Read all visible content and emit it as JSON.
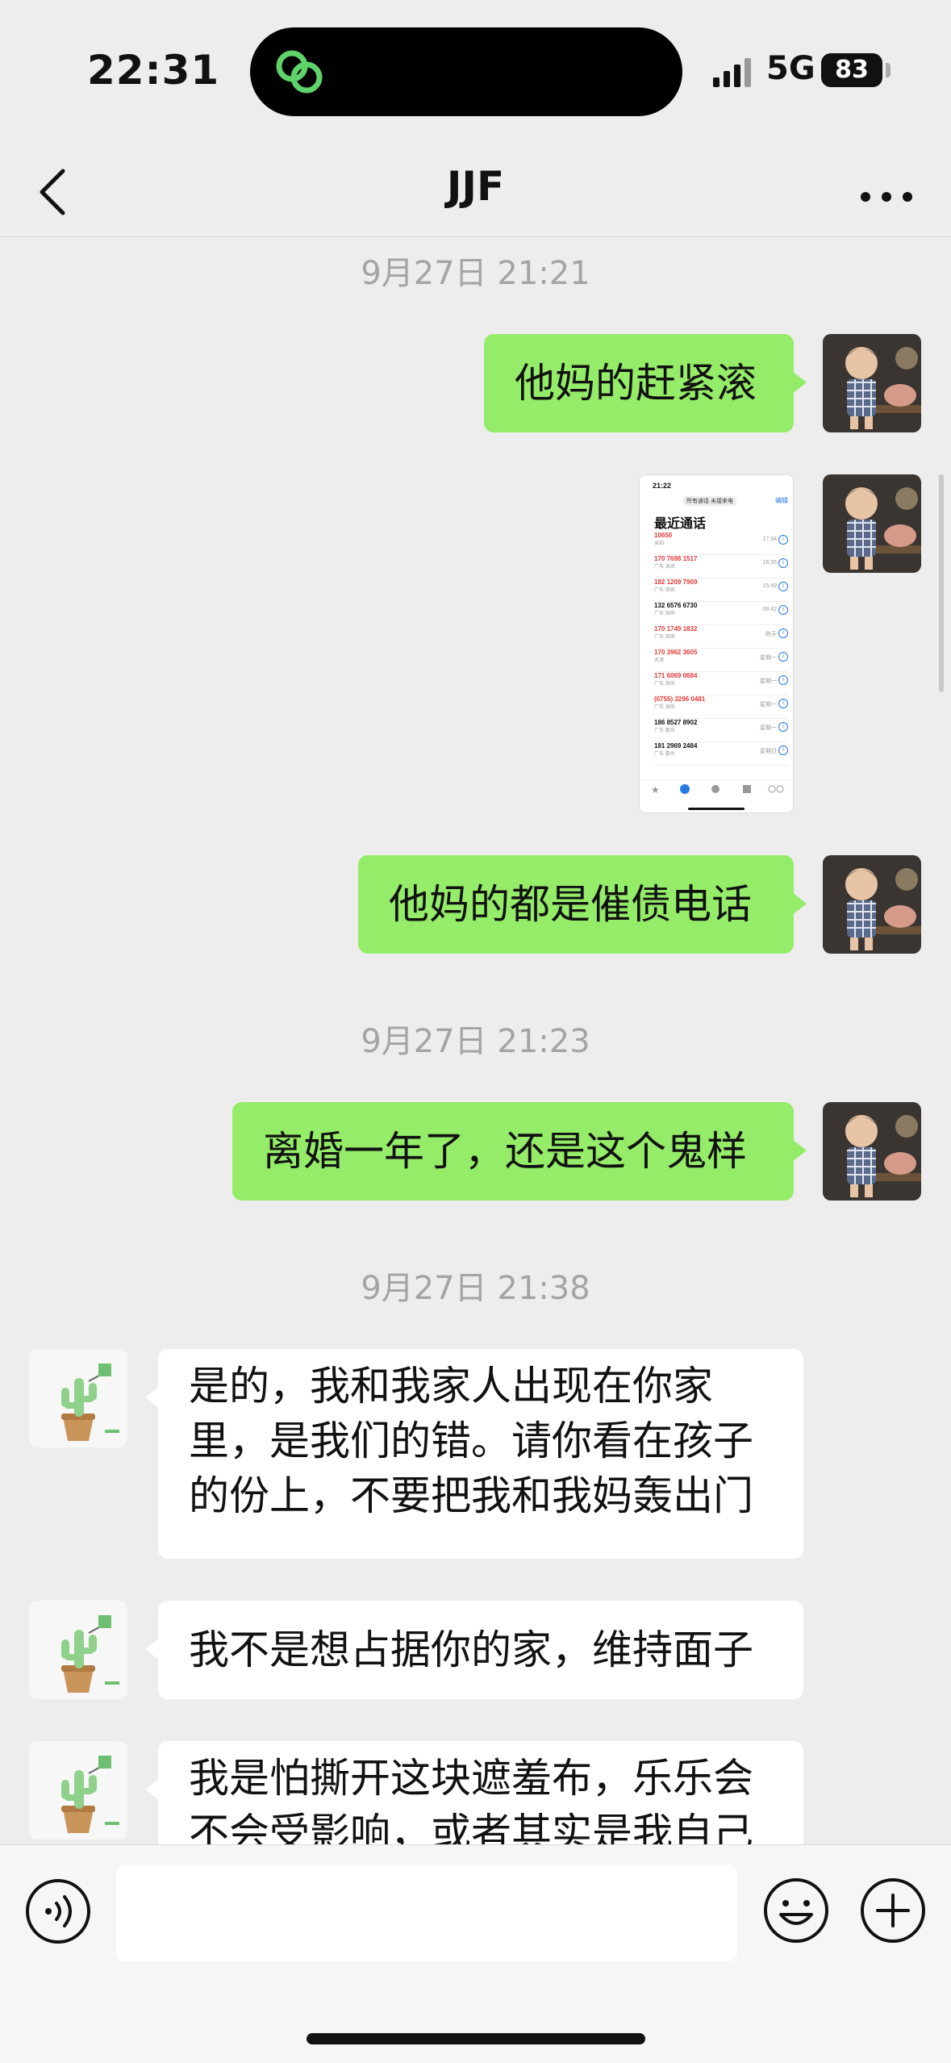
{
  "status_bar": {
    "time": "22:31",
    "network": "5G",
    "battery": "83"
  },
  "header": {
    "title": "JJF"
  },
  "timestamps": [
    "9月27日 21:21",
    "9月27日 21:23",
    "9月27日 21:38"
  ],
  "messages": {
    "out_1": "他妈的赶紧滚",
    "out_2": "他妈的都是催债电话",
    "out_3": "离婚一年了，还是这个鬼样",
    "in_1": [
      "是的，我和我家人出现在你家",
      "里，是我们的错。请你看在孩子",
      "的份上，不要把我和我妈轰出门"
    ],
    "in_2": "我不是想占据你的家，维持面子",
    "in_3": [
      "我是怕撕开这块遮羞布，乐乐会",
      "不会受影响，或者其实是我自己"
    ]
  },
  "screenshot_thumb": {
    "time": "21:22",
    "segment": "所有通话  未接来电",
    "edit": "编辑",
    "title": "最近通话",
    "rows": [
      {
        "number": "10650",
        "sub": "未知",
        "when": "17:34",
        "missed": true
      },
      {
        "number": "170 7698 1517",
        "sub": "广东 深圳",
        "when": "16:35",
        "missed": true
      },
      {
        "number": "182 1209 7909",
        "sub": "广东 深圳",
        "when": "15:59",
        "missed": true
      },
      {
        "number": "132 6576 6730",
        "sub": "广东 深圳",
        "when": "09:42",
        "missed": false
      },
      {
        "number": "170 1749 1832",
        "sub": "广东 深圳",
        "when": "昨天",
        "missed": true
      },
      {
        "number": "170 3962 3605",
        "sub": "天津",
        "when": "星期一",
        "missed": true
      },
      {
        "number": "171 6069 0684",
        "sub": "广东 深圳",
        "when": "星期一",
        "missed": true
      },
      {
        "number": "(0755) 3296 0481",
        "sub": "广东 深圳",
        "when": "星期一",
        "missed": true
      },
      {
        "number": "186 8527 8902",
        "sub": "广东 惠州",
        "when": "星期一",
        "missed": false
      },
      {
        "number": "181 2969 2484",
        "sub": "广东 惠州",
        "when": "星期日",
        "missed": false
      }
    ]
  },
  "input": {
    "placeholder": ""
  },
  "colors": {
    "outgoing_bubble": "#95ec69",
    "incoming_bubble": "#ffffff",
    "background": "#ededed"
  }
}
